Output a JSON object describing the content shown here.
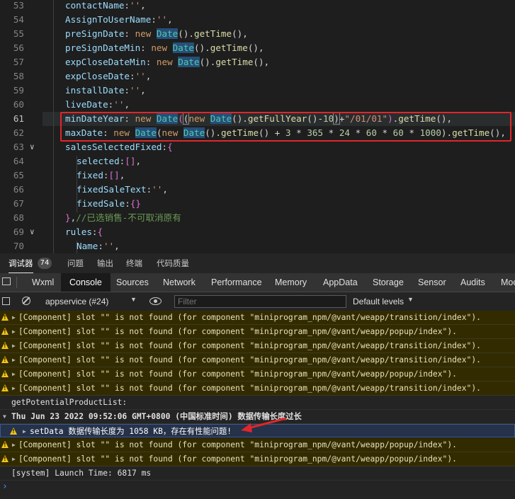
{
  "editor": {
    "lines": [
      {
        "num": "53",
        "code": "contactName:'',"
      },
      {
        "num": "54",
        "code": "AssignToUserName:'',"
      },
      {
        "num": "55",
        "code": "preSignDate: new Date().getTime(),"
      },
      {
        "num": "56",
        "code": "preSignDateMin: new Date().getTime(),"
      },
      {
        "num": "57",
        "code": "expCloseDateMin: new Date().getTime(),"
      },
      {
        "num": "58",
        "code": "expCloseDate:'',"
      },
      {
        "num": "59",
        "code": "installDate:'',"
      },
      {
        "num": "60",
        "code": "liveDate:'',"
      },
      {
        "num": "61",
        "code": "minDateYear: new Date((new Date().getFullYear()-10)+\"/01/01\").getTime(),"
      },
      {
        "num": "62",
        "code": "maxDate: new Date(new Date().getTime() + 3 * 365 * 24 * 60 * 60 * 1000).getTime(),"
      },
      {
        "num": "63",
        "code": "salesSelectedFixed:{"
      },
      {
        "num": "64",
        "code": "selected:[],"
      },
      {
        "num": "65",
        "code": "fixed:[],"
      },
      {
        "num": "66",
        "code": "fixedSaleText:'',"
      },
      {
        "num": "67",
        "code": "fixedSale:{}"
      },
      {
        "num": "68",
        "code": "},//已选销售-不可取消原有"
      },
      {
        "num": "69",
        "code": "rules:{"
      },
      {
        "num": "70",
        "code": "Name:'',"
      }
    ]
  },
  "panel_tabs": {
    "debugger": "调试器",
    "badge": "74",
    "problems": "问题",
    "output": "输出",
    "terminal": "终端",
    "quality": "代码质量"
  },
  "devtools_tabs": [
    "Wxml",
    "Console",
    "Sources",
    "Network",
    "Performance",
    "Memory",
    "AppData",
    "Storage",
    "Sensor",
    "Audits",
    "Mock"
  ],
  "console_toolbar": {
    "context": "appservice (#24)",
    "filter_placeholder": "Filter",
    "levels": "Default levels"
  },
  "console": [
    {
      "type": "warn",
      "text": "[Component] slot \"\" is not found (for component \"miniprogram_npm/@vant/weapp/transition/index\")."
    },
    {
      "type": "warn",
      "text": "[Component] slot \"\" is not found (for component \"miniprogram_npm/@vant/weapp/popup/index\")."
    },
    {
      "type": "warn",
      "text": "[Component] slot \"\" is not found (for component \"miniprogram_npm/@vant/weapp/transition/index\")."
    },
    {
      "type": "warn",
      "text": "[Component] slot \"\" is not found (for component \"miniprogram_npm/@vant/weapp/transition/index\")."
    },
    {
      "type": "warn",
      "text": "[Component] slot \"\" is not found (for component \"miniprogram_npm/@vant/weapp/popup/index\")."
    },
    {
      "type": "warn",
      "text": "[Component] slot \"\" is not found (for component \"miniprogram_npm/@vant/weapp/transition/index\")."
    },
    {
      "type": "log",
      "text": "getPotentialProductList:"
    },
    {
      "type": "group",
      "text": "Thu Jun 23 2022 09:52:06 GMT+0800 (中国标准时间) 数据传输长度过长"
    },
    {
      "type": "sel",
      "text": "setData 数据传输长度为 1058 KB，存在有性能问题!"
    },
    {
      "type": "warn",
      "text": "[Component] slot \"\" is not found (for component \"miniprogram_npm/@vant/weapp/popup/index\")."
    },
    {
      "type": "warn",
      "text": "[Component] slot \"\" is not found (for component \"miniprogram_npm/@vant/weapp/popup/index\")."
    },
    {
      "type": "log",
      "text": "[system] Launch Time: 6817 ms"
    }
  ],
  "colors": {
    "highlight_box": "#e0262a",
    "arrow": "#e0262a",
    "warn_bg": "#332b00",
    "warn_icon": "#f5c518"
  }
}
